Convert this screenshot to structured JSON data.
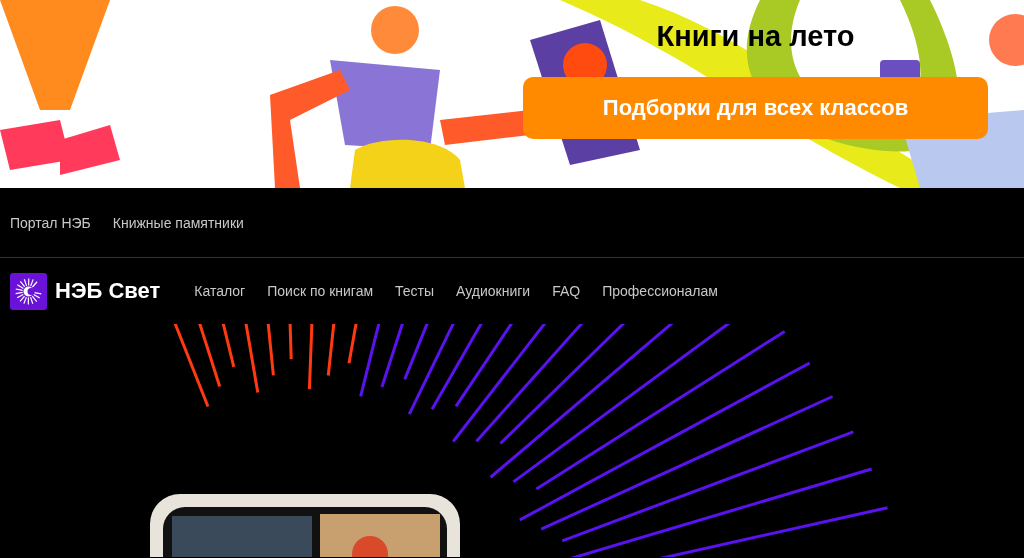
{
  "banner": {
    "title": "Книги на лето",
    "button": "Подборки для всех классов",
    "kind": "picture"
  },
  "top_links": [
    "Портал НЭБ",
    "Книжные памятники"
  ],
  "header": {
    "logo_text": "НЭБ Свет",
    "nav": [
      "Каталог",
      "Поиск по книгам",
      "Тесты",
      "Аудиокниги",
      "FAQ",
      "Профессионалам"
    ]
  }
}
